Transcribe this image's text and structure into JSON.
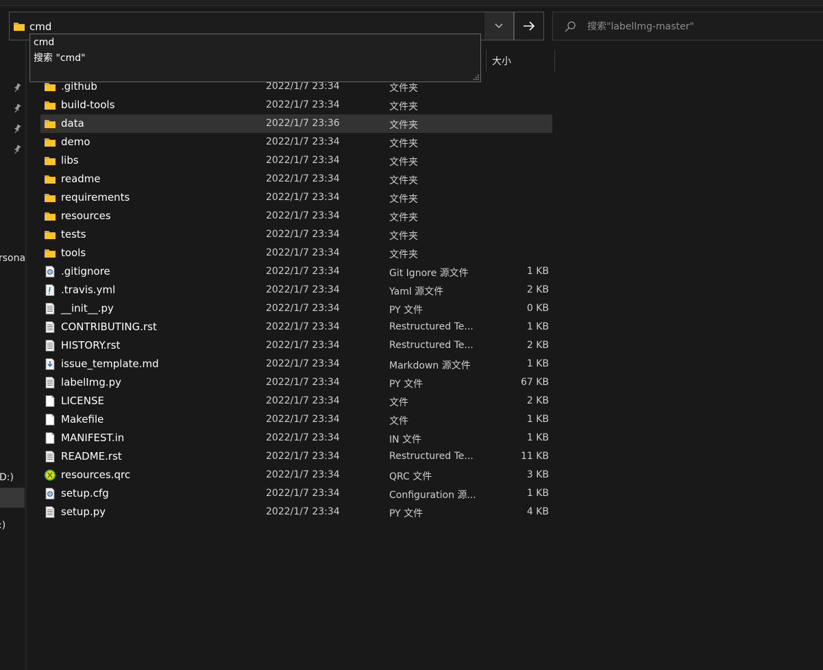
{
  "address_bar": {
    "value": "cmd",
    "icon": "folder-icon"
  },
  "search": {
    "placeholder": "搜索\"labelImg-master\""
  },
  "suggestions": [
    {
      "label": "cmd"
    },
    {
      "label": "搜索 \"cmd\""
    }
  ],
  "columns": {
    "size": "大小"
  },
  "nav": {
    "partial_labels": [
      "rsona",
      "D:)",
      ":)"
    ],
    "pins": 4
  },
  "files": [
    {
      "name": ".github",
      "date": "2022/1/7 23:34",
      "type": "文件夹",
      "size": "",
      "icon": "folder-icon"
    },
    {
      "name": "build-tools",
      "date": "2022/1/7 23:34",
      "type": "文件夹",
      "size": "",
      "icon": "folder-icon"
    },
    {
      "name": "data",
      "date": "2022/1/7 23:36",
      "type": "文件夹",
      "size": "",
      "icon": "folder-icon",
      "selected": true
    },
    {
      "name": "demo",
      "date": "2022/1/7 23:34",
      "type": "文件夹",
      "size": "",
      "icon": "folder-icon"
    },
    {
      "name": "libs",
      "date": "2022/1/7 23:34",
      "type": "文件夹",
      "size": "",
      "icon": "folder-icon"
    },
    {
      "name": "readme",
      "date": "2022/1/7 23:34",
      "type": "文件夹",
      "size": "",
      "icon": "folder-icon"
    },
    {
      "name": "requirements",
      "date": "2022/1/7 23:34",
      "type": "文件夹",
      "size": "",
      "icon": "folder-icon"
    },
    {
      "name": "resources",
      "date": "2022/1/7 23:34",
      "type": "文件夹",
      "size": "",
      "icon": "folder-icon"
    },
    {
      "name": "tests",
      "date": "2022/1/7 23:34",
      "type": "文件夹",
      "size": "",
      "icon": "folder-icon"
    },
    {
      "name": "tools",
      "date": "2022/1/7 23:34",
      "type": "文件夹",
      "size": "",
      "icon": "folder-icon"
    },
    {
      "name": ".gitignore",
      "date": "2022/1/7 23:34",
      "type": "Git Ignore 源文件",
      "size": "1 KB",
      "icon": "config-file-icon"
    },
    {
      "name": ".travis.yml",
      "date": "2022/1/7 23:34",
      "type": "Yaml 源文件",
      "size": "2 KB",
      "icon": "yaml-file-icon"
    },
    {
      "name": "__init__.py",
      "date": "2022/1/7 23:34",
      "type": "PY 文件",
      "size": "0 KB",
      "icon": "text-file-icon"
    },
    {
      "name": "CONTRIBUTING.rst",
      "date": "2022/1/7 23:34",
      "type": "Restructured Te...",
      "size": "1 KB",
      "icon": "text-file-icon"
    },
    {
      "name": "HISTORY.rst",
      "date": "2022/1/7 23:34",
      "type": "Restructured Te...",
      "size": "2 KB",
      "icon": "text-file-icon"
    },
    {
      "name": "issue_template.md",
      "date": "2022/1/7 23:34",
      "type": "Markdown 源文件",
      "size": "1 KB",
      "icon": "markdown-file-icon"
    },
    {
      "name": "labelImg.py",
      "date": "2022/1/7 23:34",
      "type": "PY 文件",
      "size": "67 KB",
      "icon": "text-file-icon"
    },
    {
      "name": "LICENSE",
      "date": "2022/1/7 23:34",
      "type": "文件",
      "size": "2 KB",
      "icon": "blank-file-icon"
    },
    {
      "name": "Makefile",
      "date": "2022/1/7 23:34",
      "type": "文件",
      "size": "1 KB",
      "icon": "blank-file-icon"
    },
    {
      "name": "MANIFEST.in",
      "date": "2022/1/7 23:34",
      "type": "IN 文件",
      "size": "1 KB",
      "icon": "blank-file-icon"
    },
    {
      "name": "README.rst",
      "date": "2022/1/7 23:34",
      "type": "Restructured Te...",
      "size": "11 KB",
      "icon": "text-file-icon"
    },
    {
      "name": "resources.qrc",
      "date": "2022/1/7 23:34",
      "type": "QRC 文件",
      "size": "3 KB",
      "icon": "qrc-file-icon"
    },
    {
      "name": "setup.cfg",
      "date": "2022/1/7 23:34",
      "type": "Configuration 源...",
      "size": "1 KB",
      "icon": "config-file-icon"
    },
    {
      "name": "setup.py",
      "date": "2022/1/7 23:34",
      "type": "PY 文件",
      "size": "4 KB",
      "icon": "text-file-icon"
    }
  ],
  "colors": {
    "background": "#191919",
    "selected_row": "#333333",
    "folder": "#f8c42a",
    "text": "#ffffff",
    "secondary_text": "#cfcfcf"
  }
}
